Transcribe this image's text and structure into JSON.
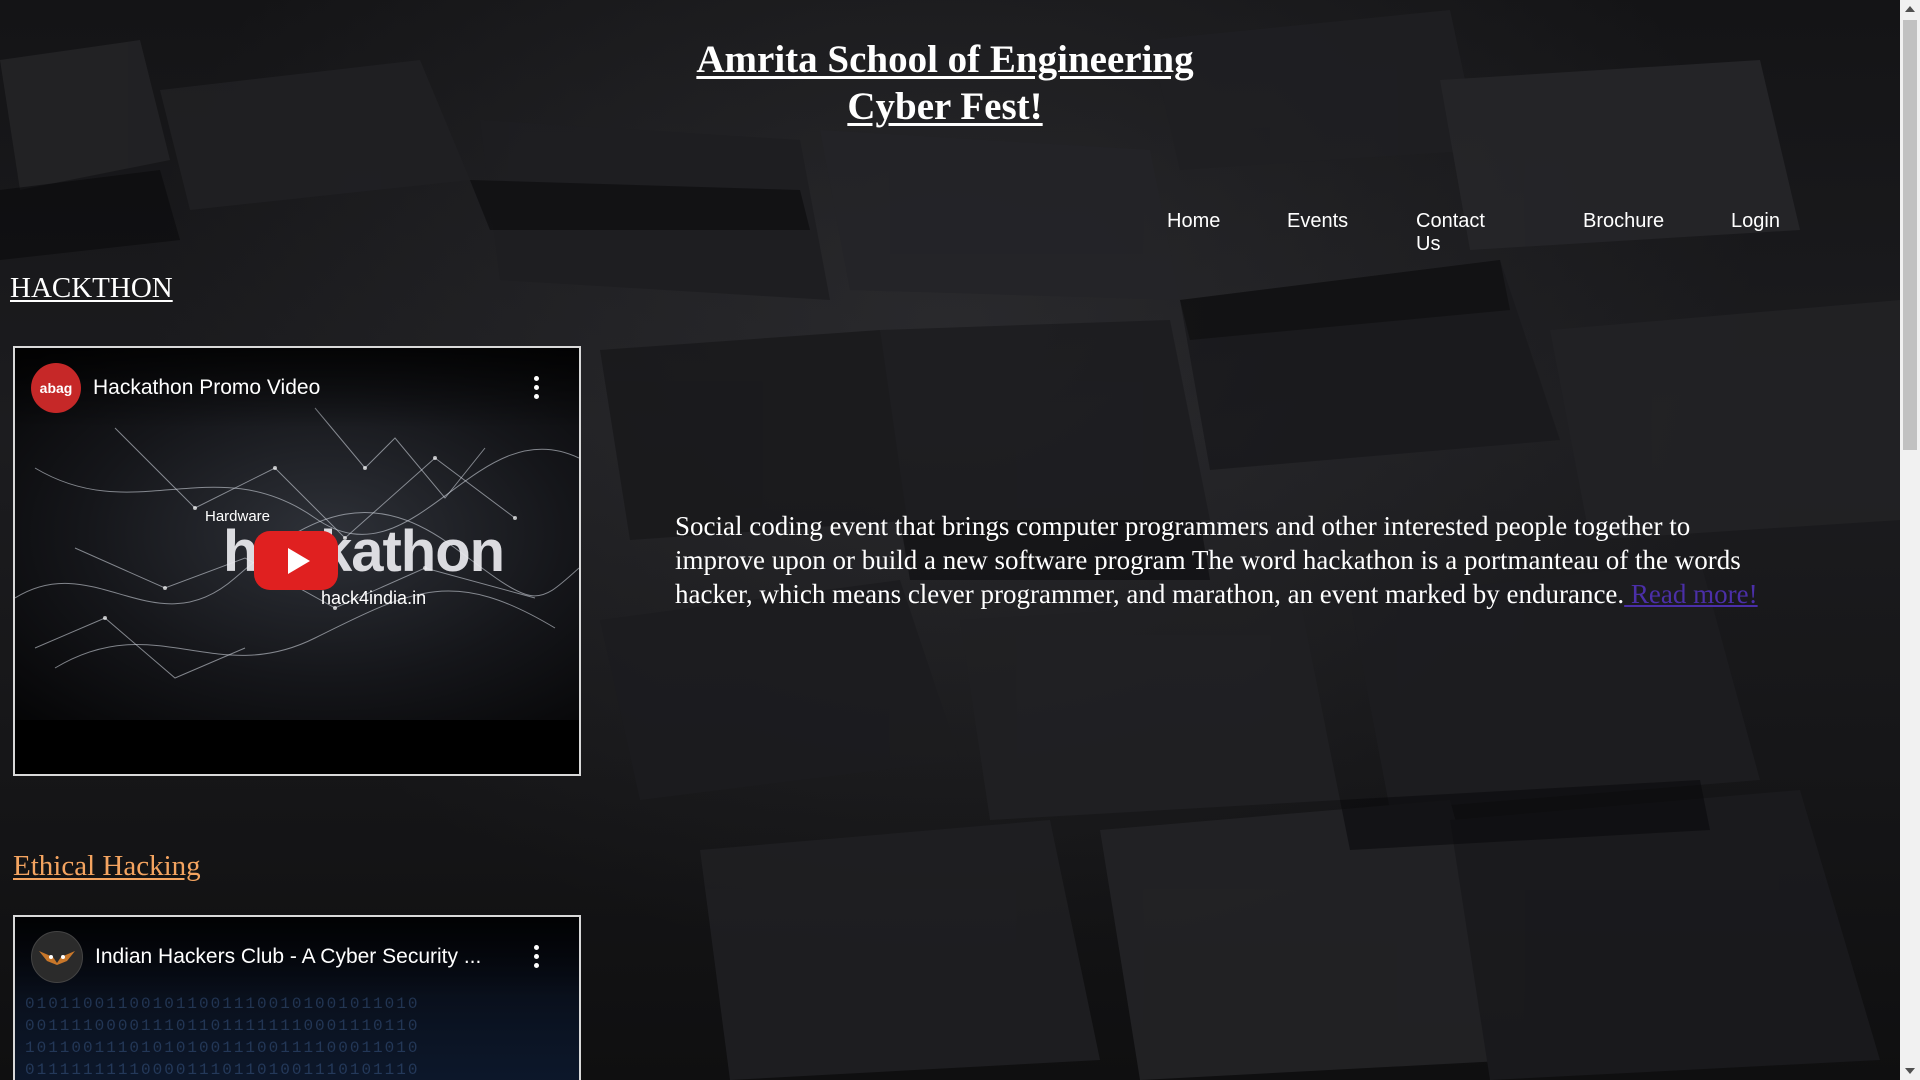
{
  "site": {
    "title_line1": "Amrita School of Engineering",
    "title_line2": "Cyber Fest!"
  },
  "nav": {
    "items": [
      {
        "label": "Home"
      },
      {
        "label": "Events"
      },
      {
        "label": "Contact Us"
      },
      {
        "label": "Brochure"
      },
      {
        "label": "Login"
      }
    ]
  },
  "sections": {
    "hackathon": {
      "heading": "HACKTHON",
      "video": {
        "title": "Hackathon Promo Video",
        "channel_avatar_text": "abag",
        "thumb_small_text": "Hardware",
        "thumb_big_text": "hackathon",
        "thumb_url_text": "hack4india.in"
      },
      "description": "Social coding event that brings computer programmers and other interested people together to improve upon or build a new software program The word hackathon is a portmanteau  of the words hacker, which means clever programmer, and marathon, an event marked by endurance.",
      "read_more": " Read more!"
    },
    "ethical_hacking": {
      "heading": "Ethical Hacking",
      "video": {
        "title": "Indian Hackers Club - A Cyber Security ..."
      }
    }
  },
  "colors": {
    "ethical_heading": "#f4a460",
    "read_more_link": "#4b2fa8",
    "play_button": "#e02020"
  },
  "icons": {
    "play": "play-icon",
    "more": "kebab-menu-icon"
  }
}
